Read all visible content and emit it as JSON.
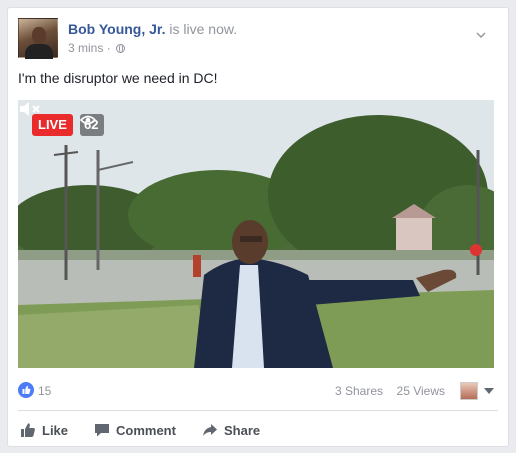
{
  "post": {
    "author": "Bob Young, Jr.",
    "status": "is live now.",
    "time": "3 mins",
    "separator": "·",
    "text": "I'm the disruptor we need in DC!"
  },
  "video": {
    "live_label": "LIVE",
    "viewer_count": "62",
    "colors": {
      "live": "#ea2b2b",
      "sky": "#dfe6ea",
      "grass": "#7c9a55"
    }
  },
  "stats": {
    "likes": "15",
    "shares": "3 Shares",
    "views": "25 Views"
  },
  "actions": {
    "like": "Like",
    "comment": "Comment",
    "share": "Share"
  },
  "icons": [
    "globe-icon",
    "chevron-down-icon",
    "eye-icon",
    "mute-icon",
    "thumbs-up-icon",
    "comment-icon",
    "share-icon"
  ]
}
